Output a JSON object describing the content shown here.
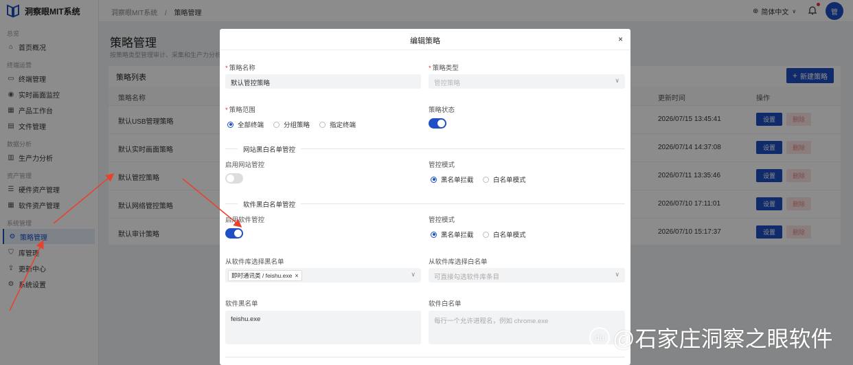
{
  "app": {
    "title": "洞察眼MIT系统"
  },
  "sidebar": {
    "groups": [
      "总览",
      "终端运营",
      "数据分析",
      "资产管理",
      "系统管理"
    ],
    "items": [
      {
        "label": "首页概况",
        "icon": "home-icon"
      },
      {
        "label": "终端管理",
        "icon": "monitor-icon"
      },
      {
        "label": "实时画面监控",
        "icon": "eye-icon"
      },
      {
        "label": "产品工作台",
        "icon": "grid-icon"
      },
      {
        "label": "文件管理",
        "icon": "file-icon"
      },
      {
        "label": "生产力分析",
        "icon": "chart-icon"
      },
      {
        "label": "硬件资产管理",
        "icon": "list-icon"
      },
      {
        "label": "软件资产管理",
        "icon": "grid-icon"
      },
      {
        "label": "策略管理",
        "icon": "gear-icon",
        "active": true
      },
      {
        "label": "库管理",
        "icon": "shield-icon"
      },
      {
        "label": "更新中心",
        "icon": "upload-icon"
      },
      {
        "label": "系统设置",
        "icon": "gear-icon"
      }
    ]
  },
  "topbar": {
    "breadcrumb": [
      "洞察眼MIT系统",
      "策略管理"
    ],
    "separator": "/",
    "language": "简体中文",
    "avatar_text": "管"
  },
  "page": {
    "title": "策略管理",
    "subtitle": "按策略类型管理审计、采集和生产力分析"
  },
  "list": {
    "title": "策略列表",
    "new_button": "新建策略",
    "columns": {
      "name": "策略名称",
      "updated": "更新时间",
      "actions": "操作"
    },
    "rows": [
      {
        "name": "默认USB管理策略",
        "updated": "2026/07/15 13:45:41"
      },
      {
        "name": "默认实时画面策略",
        "updated": "2026/07/14 14:37:08"
      },
      {
        "name": "默认管控策略",
        "updated": "2026/07/11 13:35:46"
      },
      {
        "name": "默认网络管控策略",
        "updated": "2026/07/10 17:11:01"
      },
      {
        "name": "默认审计策略",
        "updated": "2026/07/10 15:17:37"
      }
    ],
    "set_label": "设置",
    "delete_label": "删除"
  },
  "modal": {
    "title": "编辑策略",
    "close": "×",
    "name_label": "策略名称",
    "name_value": "默认管控策略",
    "type_label": "策略类型",
    "type_value": "管控策略",
    "scope_label": "策略范围",
    "scope_options": [
      "全部终端",
      "分组策略",
      "指定终端"
    ],
    "scope_selected": "全部终端",
    "status_label": "策略状态",
    "status_on": true,
    "web_section": "网站黑白名单管控",
    "web_enable_label": "启用网站管控",
    "web_enabled": false,
    "web_mode_label": "管控模式",
    "mode_options": [
      "黑名单拦截",
      "白名单模式"
    ],
    "web_mode_selected": "黑名单拦截",
    "soft_section": "软件黑白名单管控",
    "soft_enable_label": "启用软件管控",
    "soft_enabled": true,
    "soft_mode_label": "管控模式",
    "soft_mode_selected": "黑名单拦截",
    "black_select_label": "从软件库选择黑名单",
    "black_select_tag": "即时通讯类 / feishu.exe",
    "white_select_label": "从软件库选择白名单",
    "white_select_placeholder": "可直接勾选软件库条目",
    "blacklist_label": "软件黑名单",
    "blacklist_value": "feishu.exe",
    "whitelist_label": "软件白名单",
    "whitelist_placeholder": "每行一个允许进程名，例如 chrome.exe"
  },
  "watermark": "@石家庄洞察之眼软件",
  "colors": {
    "accent": "#1e4fc4",
    "danger": "#e33333",
    "annotation": "#e8412c"
  }
}
